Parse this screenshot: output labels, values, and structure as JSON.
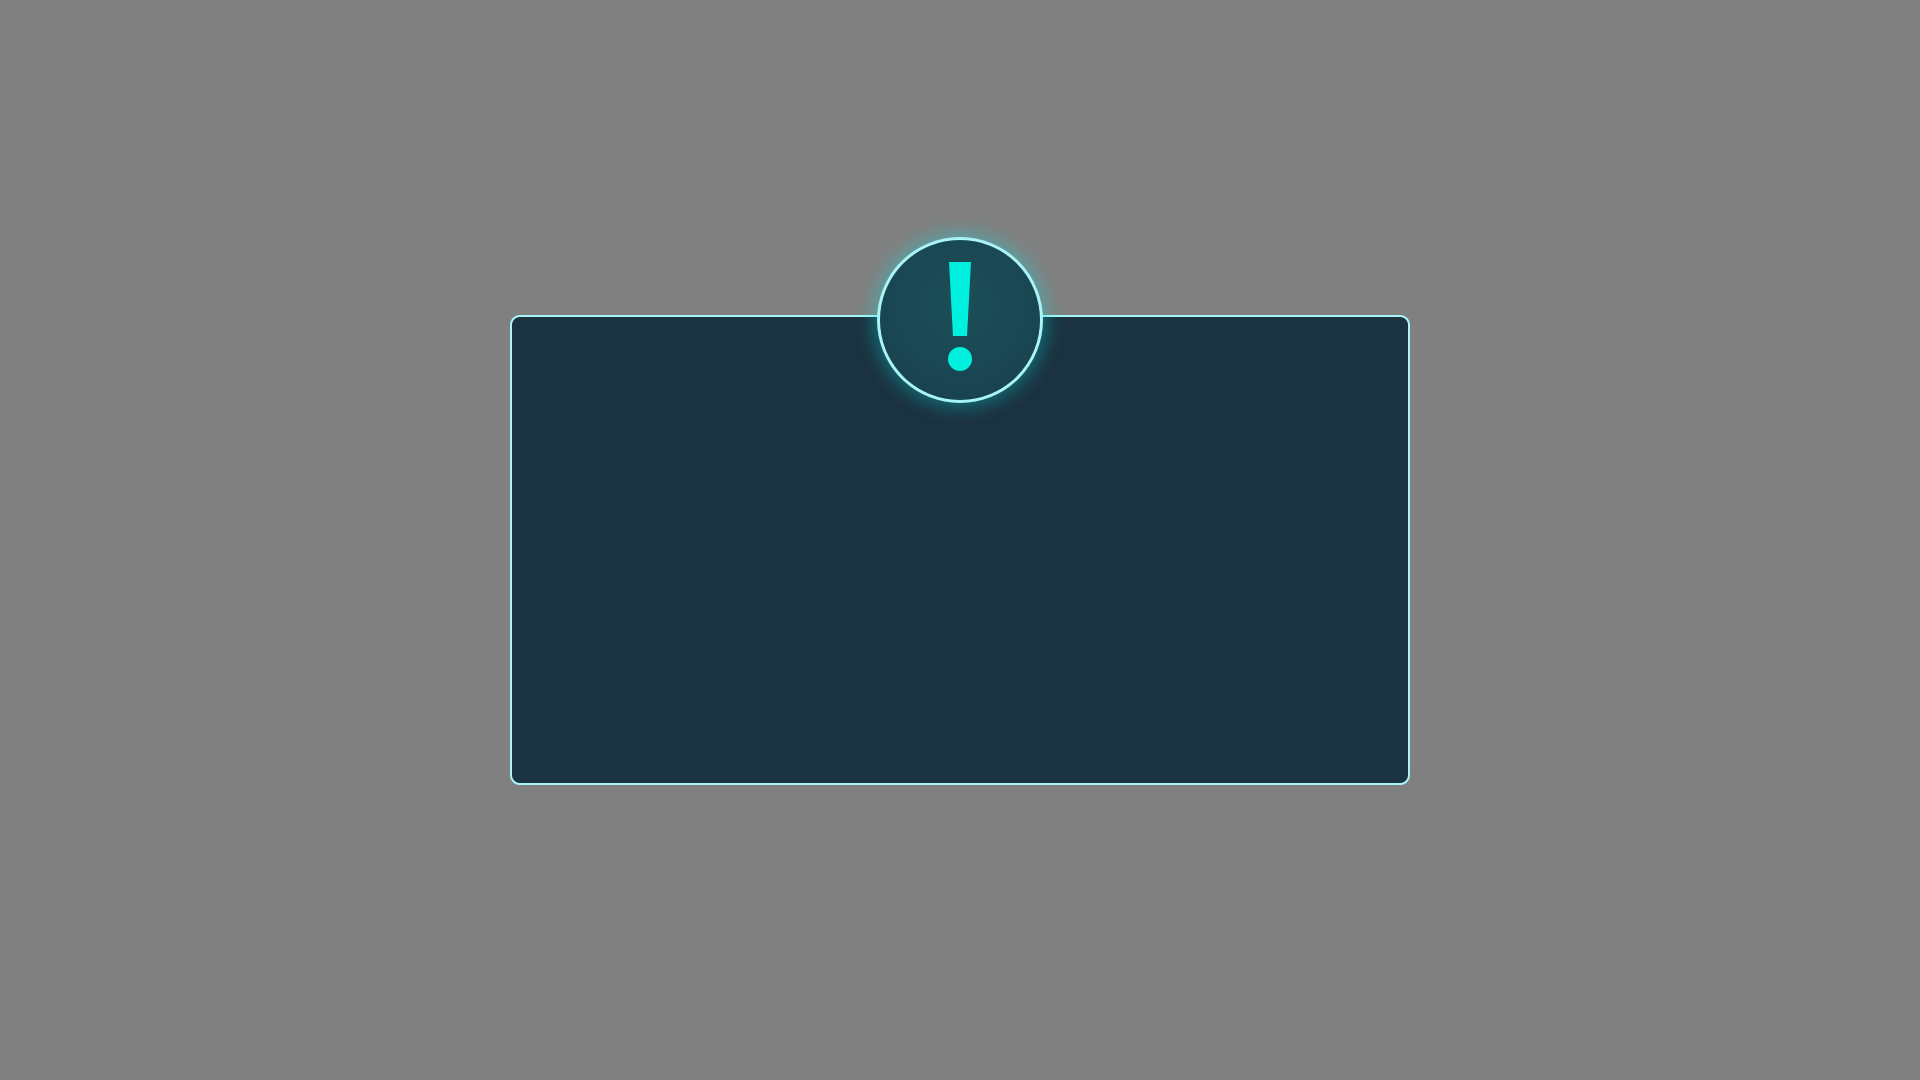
{
  "dialog": {
    "icon": "exclamation-icon",
    "colors": {
      "background": "#808080",
      "panel_fill": "#1b3240",
      "panel_border": "#a8f4f7",
      "badge_fill": "#1a4753",
      "accent": "#00f0e0"
    }
  }
}
